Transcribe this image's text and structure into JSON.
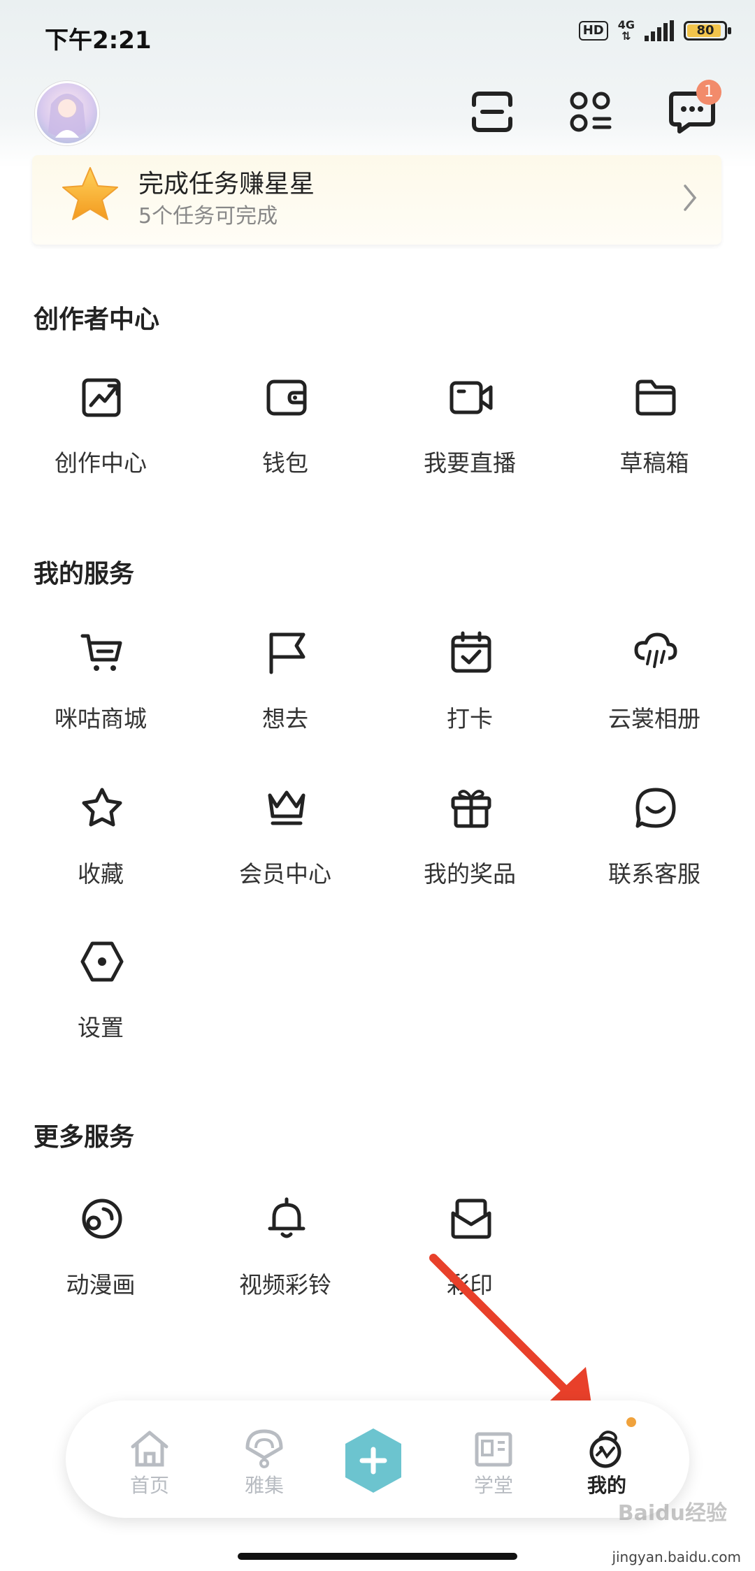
{
  "status_bar": {
    "time": "下午2:21",
    "hd": "HD",
    "network": "4G",
    "battery": "80"
  },
  "header": {
    "message_badge": "1"
  },
  "task_banner": {
    "title": "完成任务赚星星",
    "subtitle": "5个任务可完成"
  },
  "creator_center": {
    "title": "创作者中心",
    "items": [
      {
        "label": "创作中心",
        "icon": "trend-chart-icon"
      },
      {
        "label": "钱包",
        "icon": "wallet-icon"
      },
      {
        "label": "我要直播",
        "icon": "video-camera-icon"
      },
      {
        "label": "草稿箱",
        "icon": "folder-icon"
      }
    ]
  },
  "my_services": {
    "title": "我的服务",
    "items": [
      {
        "label": "咪咕商城",
        "icon": "cart-icon"
      },
      {
        "label": "想去",
        "icon": "flag-icon"
      },
      {
        "label": "打卡",
        "icon": "calendar-check-icon"
      },
      {
        "label": "云裳相册",
        "icon": "cloud-rain-icon"
      },
      {
        "label": "收藏",
        "icon": "star-icon"
      },
      {
        "label": "会员中心",
        "icon": "crown-icon"
      },
      {
        "label": "我的奖品",
        "icon": "gift-icon"
      },
      {
        "label": "联系客服",
        "icon": "chat-smile-icon"
      },
      {
        "label": "设置",
        "icon": "hexagon-settings-icon"
      }
    ]
  },
  "more_services": {
    "title": "更多服务",
    "items": [
      {
        "label": "动漫画",
        "icon": "anime-face-icon"
      },
      {
        "label": "视频彩铃",
        "icon": "bell-icon"
      },
      {
        "label": "彩印",
        "icon": "envelope-icon"
      }
    ]
  },
  "tab_bar": {
    "items": [
      {
        "label": "首页",
        "icon": "home-icon"
      },
      {
        "label": "雅集",
        "icon": "fan-icon"
      },
      {
        "label": "学堂",
        "icon": "school-icon"
      },
      {
        "label": "我的",
        "icon": "mascot-icon"
      }
    ]
  },
  "watermark": {
    "text": "Baidu经验",
    "url": "jingyan.baidu.com"
  },
  "colors": {
    "accent_teal": "#6cc4cf",
    "badge": "#f28b6b",
    "task_bg": "#fdf9ea",
    "arrow_red": "#e8402a"
  }
}
